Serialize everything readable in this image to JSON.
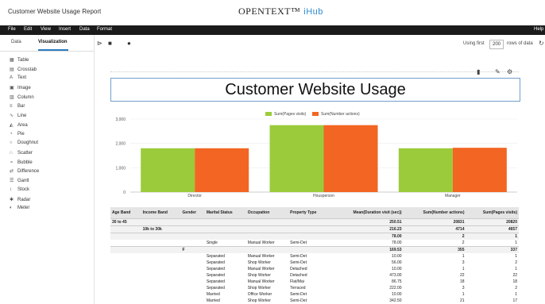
{
  "app": {
    "title": "Customer Website Usage Report",
    "brand": "OPENTEXT™",
    "brand_sub": "iHub"
  },
  "menu": [
    "File",
    "Edit",
    "View",
    "Insert",
    "Data",
    "Format"
  ],
  "help": "Help",
  "sidebar": {
    "tabs": [
      "Data",
      "Visualization"
    ],
    "items": [
      {
        "label": "Table",
        "icon": "table-icon"
      },
      {
        "label": "Crosstab",
        "icon": "crosstab-icon"
      },
      {
        "label": "Text",
        "icon": "text-icon"
      },
      {
        "label": "Image",
        "icon": "image-icon"
      },
      {
        "label": "Column",
        "icon": "column-icon"
      },
      {
        "label": "Bar",
        "icon": "bar-icon"
      },
      {
        "label": "Line",
        "icon": "line-icon"
      },
      {
        "label": "Area",
        "icon": "area-icon"
      },
      {
        "label": "Pie",
        "icon": "pie-icon"
      },
      {
        "label": "Doughnut",
        "icon": "doughnut-icon"
      },
      {
        "label": "Scatter",
        "icon": "scatter-icon"
      },
      {
        "label": "Bubble",
        "icon": "bubble-icon"
      },
      {
        "label": "Difference",
        "icon": "difference-icon"
      },
      {
        "label": "Gantt",
        "icon": "gantt-icon"
      },
      {
        "label": "Stock",
        "icon": "stock-icon"
      },
      {
        "label": "Radar",
        "icon": "radar-icon"
      },
      {
        "label": "Meter",
        "icon": "meter-icon"
      }
    ]
  },
  "toolbar": {
    "using_first": "Using first",
    "rows_value": "200",
    "rows_of_data": "rows of data"
  },
  "report": {
    "header": "Customer Website Usage"
  },
  "colors": {
    "green": "#9bcb3b",
    "orange": "#f26522"
  },
  "chart_data": {
    "type": "bar",
    "categories": [
      "Director",
      "Housperson",
      "Manager"
    ],
    "series": [
      {
        "name": "Sum(Pages visits)",
        "values": [
          1800,
          2750,
          1800
        ]
      },
      {
        "name": "Sum(Number actions)",
        "values": [
          1800,
          2750,
          1820
        ]
      }
    ],
    "ylim": [
      0,
      3000
    ],
    "yticks": [
      "0",
      "1,000",
      "2,000",
      "3,000"
    ],
    "legend": "top"
  },
  "table": {
    "headers": [
      "Age Band",
      "Income Band",
      "Gender",
      "Marital Status",
      "Occupation",
      "Property Type",
      "Mean(Duration visit (sec))",
      "Sum(Number actions)",
      "Sum(Pages visits)"
    ],
    "rows": [
      {
        "cls": "sub",
        "cells": [
          "30 to 45",
          "",
          "",
          "",
          "",
          "",
          "250.51",
          "20831",
          "20820"
        ]
      },
      {
        "cls": "sub",
        "cells": [
          "",
          "10k to 30k",
          "",
          "",
          "",
          "",
          "216.23",
          "4714",
          "4657"
        ]
      },
      {
        "cls": "sub",
        "cells": [
          "",
          "",
          "",
          "",
          "",
          "",
          "78.00",
          "2",
          "1"
        ]
      },
      {
        "cls": "",
        "cells": [
          "",
          "",
          "",
          "Single",
          "Manual Worker",
          "Semi-Det",
          "78.00",
          "2",
          "1"
        ]
      },
      {
        "cls": "sub",
        "cells": [
          "",
          "",
          "F",
          "",
          "",
          "",
          "169.53",
          "355",
          "337"
        ]
      },
      {
        "cls": "",
        "cells": [
          "",
          "",
          "",
          "Separated",
          "Manual Worker",
          "Semi-Det",
          "10.00",
          "1",
          "1"
        ]
      },
      {
        "cls": "",
        "cells": [
          "",
          "",
          "",
          "Separated",
          "Shop Worker",
          "Semi-Det",
          "56.00",
          "3",
          "2"
        ]
      },
      {
        "cls": "",
        "cells": [
          "",
          "",
          "",
          "Separated",
          "Manual Worker",
          "Detached",
          "10.00",
          "1",
          "1"
        ]
      },
      {
        "cls": "",
        "cells": [
          "",
          "",
          "",
          "Separated",
          "Shop Worker",
          "Detached",
          "473.00",
          "22",
          "22"
        ]
      },
      {
        "cls": "",
        "cells": [
          "",
          "",
          "",
          "Separated",
          "Manual Worker",
          "Flat/Mai",
          "86.75",
          "18",
          "18"
        ]
      },
      {
        "cls": "",
        "cells": [
          "",
          "",
          "",
          "Separated",
          "Shop Worker",
          "Terraced",
          "222.00",
          "3",
          "2"
        ]
      },
      {
        "cls": "",
        "cells": [
          "",
          "",
          "",
          "Married",
          "Office Worker",
          "Semi-Det",
          "10.00",
          "1",
          "1"
        ]
      },
      {
        "cls": "",
        "cells": [
          "",
          "",
          "",
          "Married",
          "Shop Worker",
          "Semi-Det",
          "342.50",
          "21",
          "17"
        ]
      }
    ]
  }
}
